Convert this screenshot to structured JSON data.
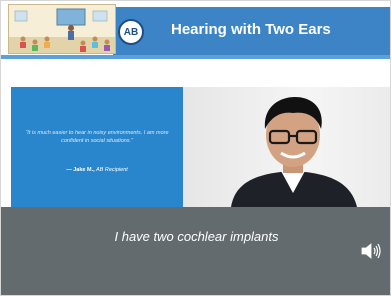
{
  "slide": {
    "title": "Hearing with Two Ears",
    "logo_text": "AB",
    "quote": {
      "text": "“It is much easier to hear in noisy environments. I am more confident in social situations.”",
      "author": "— Jake M.,",
      "role": "AB Recipient"
    },
    "caption": "I have two cochlear implants",
    "icons": [
      "classroom-illustration",
      "person-photo",
      "speaker-icon"
    ]
  },
  "colors": {
    "header_blue": "#3d84c6",
    "quote_blue": "#2a86cc",
    "caption_gray": "#636b6f",
    "logo_navy": "#1d4f86"
  }
}
